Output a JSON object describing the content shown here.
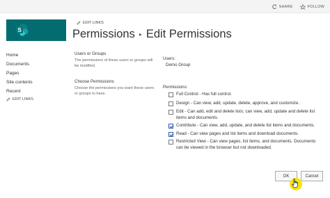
{
  "topbar": {
    "share_label": "SHARE",
    "follow_label": "FOLLOW"
  },
  "edit_links_label": "EDIT LINKS",
  "logo": {
    "letter": "S"
  },
  "page_title": {
    "part1": "Permissions",
    "separator": "▸",
    "part2": "Edit Permissions"
  },
  "leftnav": {
    "items": [
      "Home",
      "Documents",
      "Pages",
      "Site contents",
      "Recent"
    ],
    "edit_label": "EDIT LINKS"
  },
  "users_section": {
    "title": "Users or Groups",
    "description": "The permissions of these users or groups will be modified.",
    "users_label": "Users:",
    "users_value": "Demo Group"
  },
  "permissions_section": {
    "title": "Choose Permissions",
    "description": "Choose the permissions you want these users or groups to have.",
    "permissions_label": "Permissions:",
    "options": [
      {
        "text": "Full Control - Has full control.",
        "checked": false
      },
      {
        "text": "Design - Can view, add, update, delete, approve, and customize.",
        "checked": false
      },
      {
        "text": "Edit - Can add, edit and delete lists; can view, add, update and delete list items and documents.",
        "checked": false
      },
      {
        "text": "Contribute - Can view, add, update, and delete list items and documents.",
        "checked": true
      },
      {
        "text": "Read - Can view pages and list items and download documents.",
        "checked": true
      },
      {
        "text": "Restricted View - Can view pages, list items, and documents. Documents can be viewed in the browser but not downloaded.",
        "checked": false
      }
    ]
  },
  "buttons": {
    "ok_label": "OK",
    "cancel_label": "Cancel"
  },
  "colors": {
    "logo_bg": "#036c70",
    "cursor_highlight": "#f7e400"
  }
}
